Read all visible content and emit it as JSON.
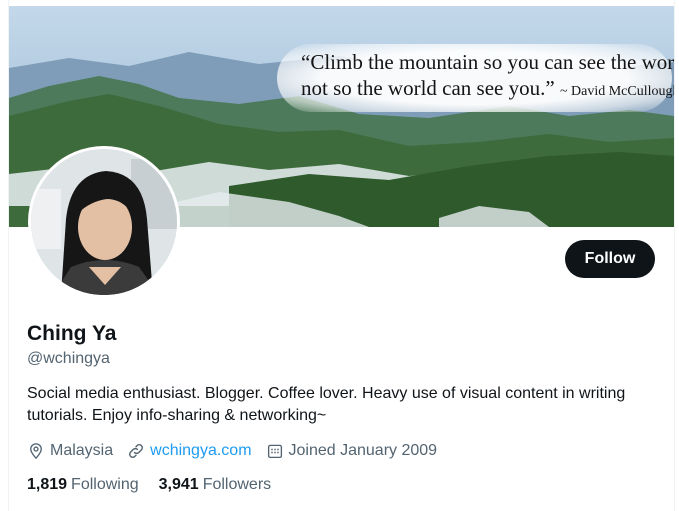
{
  "banner": {
    "quote_line1": "“Climb the mountain so you can see the world,",
    "quote_line2": "not so the world can see you.”",
    "quote_author": "~ David McCullough Jr."
  },
  "profile": {
    "name": "Ching Ya",
    "handle": "@wchingya",
    "bio": "Social media enthusiast. Blogger. Coffee lover. Heavy use of visual content in writing tutorials. Enjoy info-sharing & networking~",
    "location": "Malaysia",
    "website": "wchingya.com",
    "joined": "Joined January 2009",
    "following_count": "1,819",
    "following_label": "Following",
    "followers_count": "3,941",
    "followers_label": "Followers"
  },
  "actions": {
    "follow_label": "Follow"
  },
  "icons": {
    "location": "location-pin-icon",
    "website": "link-icon",
    "joined": "calendar-icon"
  },
  "colors": {
    "text_primary": "#0f1419",
    "text_secondary": "#536471",
    "link": "#1d9bf0",
    "button_bg": "#0f1419"
  }
}
